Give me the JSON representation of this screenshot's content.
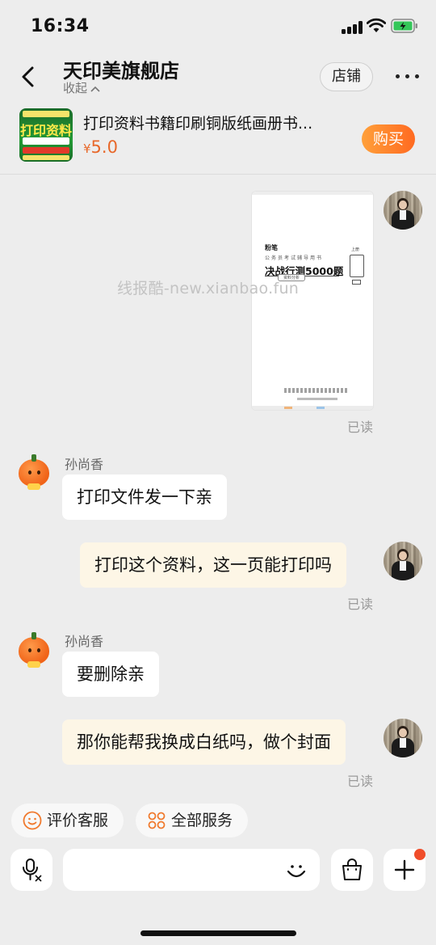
{
  "status_bar": {
    "time": "16:34"
  },
  "header": {
    "shop_name": "天印美旗舰店",
    "collapse_label": "收起",
    "store_button": "店铺"
  },
  "product": {
    "thumbnail_text": "打印资料",
    "title": "打印资料书籍印刷铜版纸画册书...",
    "currency": "¥",
    "price": "5.0",
    "buy_button": "购买"
  },
  "chat": {
    "image_message": {
      "brand": "粉笔",
      "subtitle": "公务员考试辅导用书",
      "title": "决战行测5000题",
      "edition": "资料分析",
      "volume": "上册"
    },
    "watermark": "线报酷-new.xianbao.fun",
    "read_label": "已读",
    "messages": [
      {
        "sender": "孙尚香",
        "text": "打印文件发一下亲"
      },
      {
        "text": "打印这个资料，这一页能打印吗"
      },
      {
        "sender": "孙尚香",
        "text": "要删除亲"
      },
      {
        "text": "那你能帮我换成白纸吗，做个封面"
      }
    ]
  },
  "quick_actions": [
    {
      "label": "评价客服",
      "icon": "smile-icon"
    },
    {
      "label": "全部服务",
      "icon": "grid-icon"
    }
  ],
  "colors": {
    "accent": "#ff6a21",
    "background": "#ededed",
    "outgoing_bubble": "#fdf6e6"
  }
}
